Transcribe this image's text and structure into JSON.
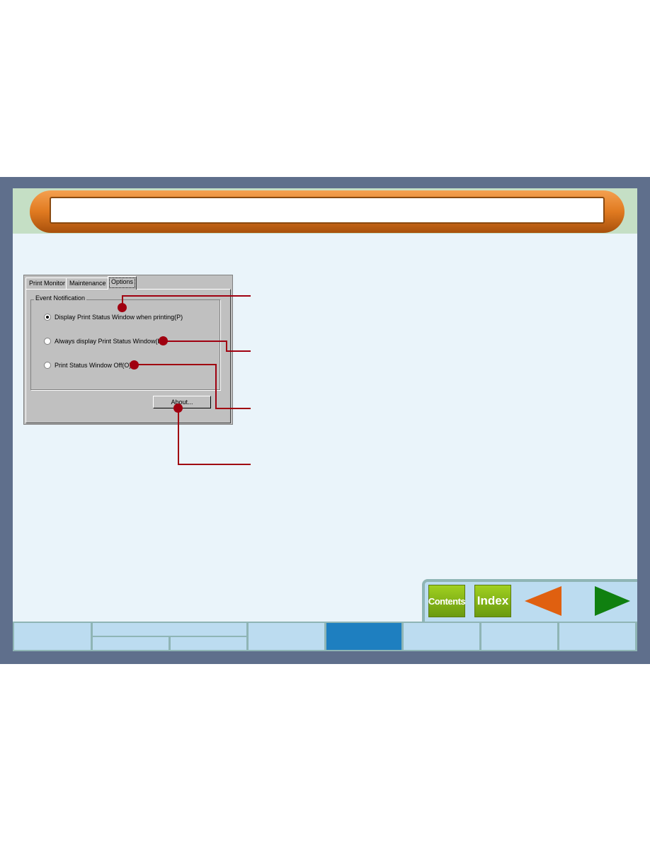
{
  "dialog": {
    "tabs": [
      "Print Monitor",
      "Maintenance",
      "Options"
    ],
    "active_tab": "Options",
    "group_label": "Event Notification",
    "options": [
      {
        "label": "Display Print Status Window when printing(P)",
        "selected": true
      },
      {
        "label": "Always display Print Status Window(L)",
        "selected": false
      },
      {
        "label": "Print Status Window Off(O)",
        "selected": false
      }
    ],
    "about_button": "About..."
  },
  "nav": {
    "contents": "Contents",
    "index": "Index",
    "prev_icon": "arrow-left-icon",
    "next_icon": "arrow-right-icon",
    "active_tab_color": "#1e7fc0"
  },
  "colors": {
    "callout": "#a00010",
    "frame": "#5f6f8c"
  }
}
